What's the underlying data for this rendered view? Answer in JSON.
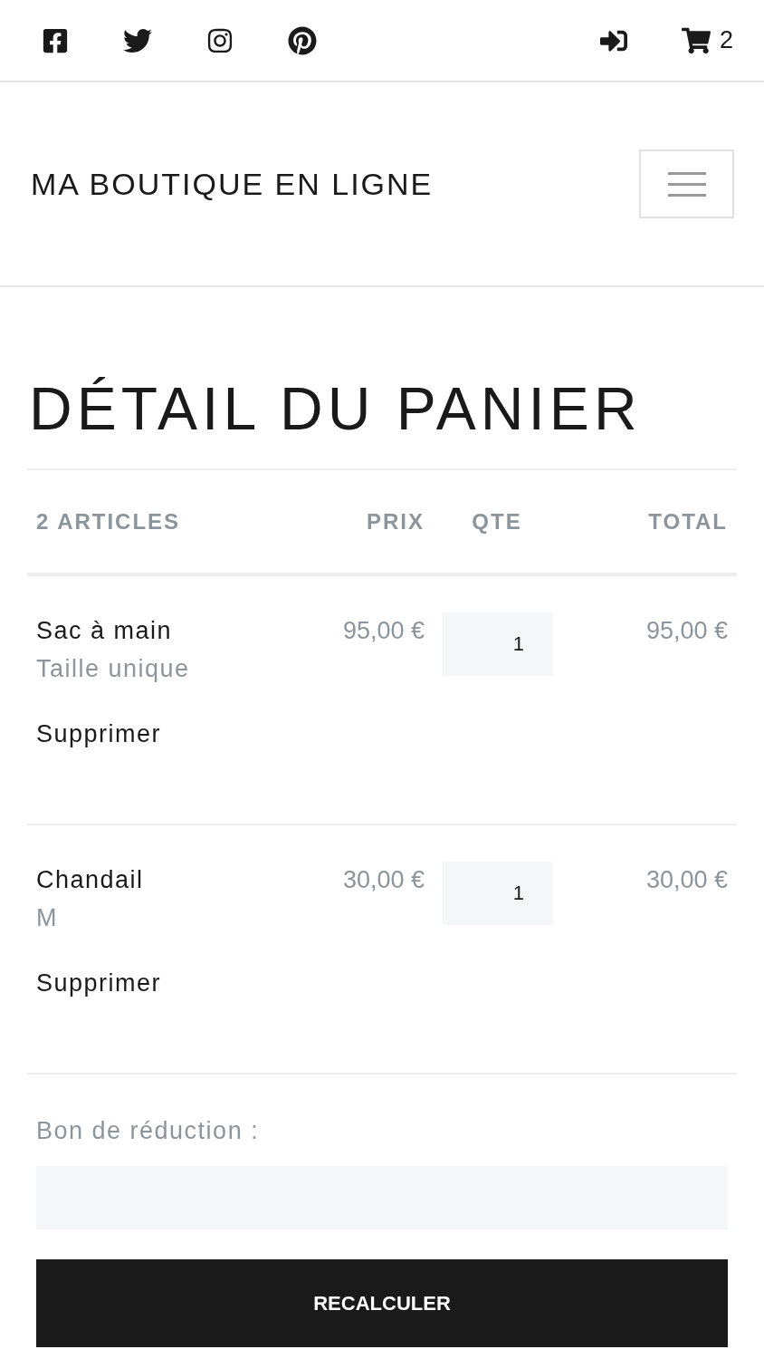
{
  "top_bar": {
    "cart_count": "2"
  },
  "header": {
    "brand": "MA BOUTIQUE EN LIGNE"
  },
  "page_title": "DÉTAIL DU PANIER",
  "table": {
    "columns": [
      "2 ARTICLES",
      "PRIX",
      "QTE",
      "TOTAL"
    ],
    "rows": [
      {
        "name": "Sac à main",
        "variant": "Taille unique",
        "price": "95,00 €",
        "quantity": "1",
        "total": "95,00 €",
        "remove": "Supprimer"
      },
      {
        "name": "Chandail",
        "variant": "M",
        "price": "30,00 €",
        "quantity": "1",
        "total": "30,00 €",
        "remove": "Supprimer"
      }
    ]
  },
  "coupon": {
    "label": "Bon de réduction :"
  },
  "recalculate_button": "RECALCULER"
}
